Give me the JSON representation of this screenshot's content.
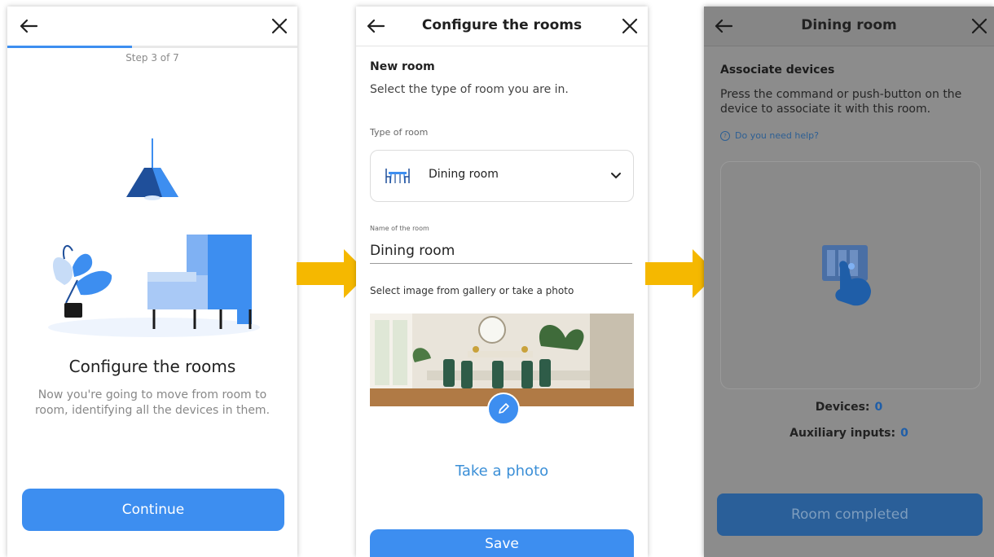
{
  "screens": {
    "intro": {
      "step_text": "Step 3 of 7",
      "progress": 0.43,
      "title": "Configure the rooms",
      "description": "Now you're going to move from room to room, identifying all the devices in them.",
      "continue_label": "Continue"
    },
    "configure": {
      "header_title": "Configure the rooms",
      "section_title": "New room",
      "section_subtitle": "Select the type of room you are in.",
      "type_label": "Type of room",
      "type_value": "Dining room",
      "name_label": "Name of the room",
      "name_value": "Dining room",
      "image_label": "Select image from gallery or take a photo",
      "take_photo_label": "Take a photo",
      "save_label": "Save"
    },
    "associate": {
      "header_title": "Dining room",
      "section_title": "Associate devices",
      "description": "Press the command or push-button on the device to associate it with this room.",
      "help_link": "Do you need help?",
      "devices_label": "Devices:",
      "devices_count": "0",
      "aux_label": "Auxiliary inputs:",
      "aux_count": "0",
      "room_completed_label": "Room completed"
    }
  },
  "colors": {
    "accent": "#3d8ef0",
    "link": "#3b8fd7",
    "arrow": "#f5b800",
    "overlay": "#8c8c8c"
  },
  "icons": [
    "back-arrow-icon",
    "close-icon",
    "chevron-down-icon",
    "dining-table-icon",
    "pencil-icon",
    "help-circle-icon",
    "touch-device-icon"
  ]
}
